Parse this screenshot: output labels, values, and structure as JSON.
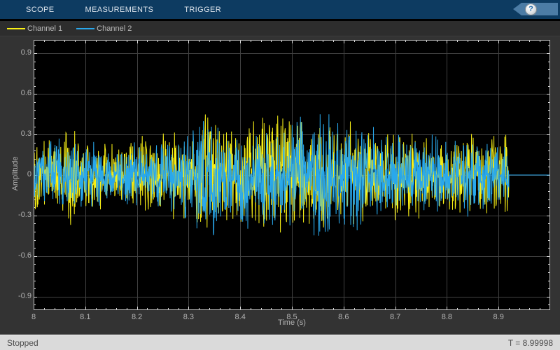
{
  "toolbar": {
    "tabs": [
      {
        "label": "SCOPE"
      },
      {
        "label": "MEASUREMENTS"
      },
      {
        "label": "TRIGGER"
      }
    ],
    "help_label": "?"
  },
  "legend": {
    "items": [
      {
        "label": "Channel 1",
        "color": "#FBF216"
      },
      {
        "label": "Channel 2",
        "color": "#29A8EC"
      }
    ]
  },
  "statusbar": {
    "left": "Stopped",
    "right": "T = 8.99998"
  },
  "chart_data": {
    "type": "line",
    "title": "",
    "xlabel": "Time (s)",
    "ylabel": "Amplitude",
    "xlim": [
      8,
      9
    ],
    "ylim": [
      -1,
      1
    ],
    "xticks": [
      8,
      8.1,
      8.2,
      8.3,
      8.4,
      8.5,
      8.6,
      8.7,
      8.8,
      8.9
    ],
    "xtick_labels": [
      "8",
      "8.1",
      "8.2",
      "8.3",
      "8.4",
      "8.5",
      "8.6",
      "8.7",
      "8.8",
      "8.9"
    ],
    "yticks": [
      -0.9,
      -0.6,
      -0.3,
      0,
      0.3,
      0.6,
      0.9
    ],
    "ytick_labels": [
      "-0.9",
      "-0.6",
      "-0.3",
      "0",
      "0.3",
      "0.6",
      "0.9"
    ],
    "minor_x_step": 0.02,
    "minor_y_step": 0.06,
    "grid": true,
    "legend_position": "top-left",
    "signal_end_time": 8.92,
    "colors": {
      "background": "#000000",
      "grid": "#414141",
      "frame": "#BEBEBE",
      "tick": "#E0E0E0",
      "tick_label": "#B3B3B3"
    },
    "noise": {
      "scale": 1.25,
      "spike_prob": 0.02,
      "spike_gain": 1.6,
      "samples": 1400
    },
    "series": [
      {
        "name": "Channel 1",
        "color": "#FBF216",
        "signal": "broadband-noise",
        "seed": 101,
        "after_end_value": 0,
        "clamp": [
          -0.5,
          0.47
        ],
        "envelope": {
          "t": [
            8.0,
            8.04,
            8.07,
            8.1,
            8.13,
            8.16,
            8.19,
            8.22,
            8.25,
            8.28,
            8.31,
            8.34,
            8.36,
            8.4,
            8.44,
            8.47,
            8.5,
            8.53,
            8.56,
            8.6,
            8.63,
            8.66,
            8.7,
            8.73,
            8.76,
            8.8,
            8.84,
            8.88,
            8.92
          ],
          "amp": [
            0.24,
            0.28,
            0.33,
            0.26,
            0.21,
            0.22,
            0.26,
            0.28,
            0.3,
            0.28,
            0.32,
            0.45,
            0.34,
            0.32,
            0.36,
            0.42,
            0.36,
            0.32,
            0.34,
            0.32,
            0.3,
            0.28,
            0.31,
            0.28,
            0.26,
            0.24,
            0.26,
            0.24,
            0.28
          ]
        }
      },
      {
        "name": "Channel 2",
        "color": "#29A8EC",
        "signal": "broadband-noise",
        "seed": 202,
        "after_end_value": 0,
        "clamp": [
          -0.56,
          0.45
        ],
        "envelope": {
          "t": [
            8.0,
            8.04,
            8.08,
            8.12,
            8.16,
            8.2,
            8.24,
            8.28,
            8.31,
            8.345,
            8.37,
            8.4,
            8.43,
            8.46,
            8.49,
            8.52,
            8.55,
            8.58,
            8.61,
            8.64,
            8.67,
            8.7,
            8.73,
            8.76,
            8.8,
            8.84,
            8.88,
            8.92
          ],
          "amp": [
            0.18,
            0.22,
            0.24,
            0.19,
            0.17,
            0.21,
            0.23,
            0.26,
            0.3,
            0.5,
            0.3,
            0.32,
            0.38,
            0.4,
            0.34,
            0.36,
            0.4,
            0.38,
            0.42,
            0.34,
            0.28,
            0.27,
            0.29,
            0.26,
            0.23,
            0.24,
            0.23,
            0.2
          ]
        }
      }
    ]
  }
}
